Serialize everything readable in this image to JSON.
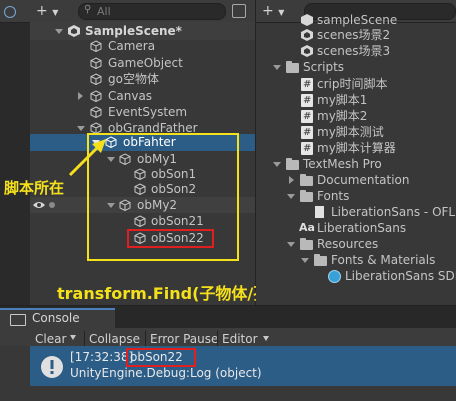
{
  "hierarchy": {
    "toolbar": {
      "add_label": "+",
      "search_placeholder": "All"
    },
    "scene": {
      "name": "SampleScene*"
    },
    "items": [
      {
        "label": "Camera"
      },
      {
        "label": "GameObject"
      },
      {
        "label": "go空物体"
      },
      {
        "label": "Canvas"
      },
      {
        "label": "EventSystem"
      },
      {
        "label": "obGrandFather"
      },
      {
        "label": "obFahter"
      },
      {
        "label": "obMy1"
      },
      {
        "label": "obSon1"
      },
      {
        "label": "obSon2"
      },
      {
        "label": "obMy2"
      },
      {
        "label": "obSon21"
      },
      {
        "label": "obSon22"
      }
    ]
  },
  "project": {
    "add_label": "+",
    "items": [
      {
        "label": "sampleScene"
      },
      {
        "label": "scenes场景2"
      },
      {
        "label": "scenes场景3"
      },
      {
        "label": "Scripts"
      },
      {
        "label": "crip时间脚本"
      },
      {
        "label": "my脚本1"
      },
      {
        "label": "my脚本2"
      },
      {
        "label": "my脚本测试"
      },
      {
        "label": "my脚本计算器"
      },
      {
        "label": "TextMesh Pro"
      },
      {
        "label": "Documentation"
      },
      {
        "label": "Fonts"
      },
      {
        "label": "LiberationSans - OFL"
      },
      {
        "label": "LiberationSans"
      },
      {
        "label": "Resources"
      },
      {
        "label": "Fonts & Materials"
      },
      {
        "label": "LiberationSans SDF"
      }
    ]
  },
  "annotations": {
    "script_location": "脚本所在",
    "find_caption": "transform.Find(子物体/孙物体)"
  },
  "console": {
    "tab_label": "Console",
    "buttons": {
      "clear": "Clear",
      "collapse": "Collapse",
      "error_pause": "Error Pause",
      "editor": "Editor"
    },
    "log": {
      "timestamp": "[17:32:38]",
      "message": "obSon22",
      "detail": "UnityEngine.Debug:Log (object)"
    }
  },
  "colors": {
    "selection": "#2c5d87",
    "annotation_yellow": "#f5e11b",
    "highlight_red": "#e02020"
  }
}
